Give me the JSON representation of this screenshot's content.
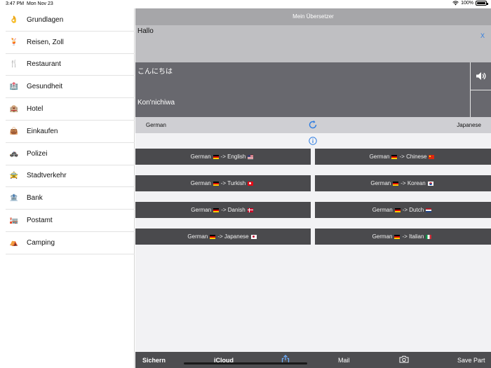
{
  "status_bar": {
    "time": "3:47 PM",
    "date": "Mon Nov 23",
    "battery": "100%"
  },
  "sidebar": {
    "items": [
      {
        "label": "Grundlagen",
        "icon": "ok-hand-icon",
        "glyph": "👌"
      },
      {
        "label": "Reisen, Zoll",
        "icon": "cocktail-icon",
        "glyph": "🍹"
      },
      {
        "label": "Restaurant",
        "icon": "fork-knife-icon",
        "glyph": "🍴"
      },
      {
        "label": "Gesundheit",
        "icon": "hospital-icon",
        "glyph": "🏥"
      },
      {
        "label": "Hotel",
        "icon": "hotel-icon",
        "glyph": "🏨"
      },
      {
        "label": "Einkaufen",
        "icon": "handbag-icon",
        "glyph": "👜"
      },
      {
        "label": "Polizei",
        "icon": "police-car-icon",
        "glyph": "🚓"
      },
      {
        "label": "Stadtverkehr",
        "icon": "taxi-icon",
        "glyph": "🚖"
      },
      {
        "label": "Bank",
        "icon": "bank-icon",
        "glyph": "🏦"
      },
      {
        "label": "Postamt",
        "icon": "post-office-icon",
        "glyph": "🏣"
      },
      {
        "label": "Camping",
        "icon": "tent-icon",
        "glyph": "⛺"
      }
    ]
  },
  "header": {
    "title": "Mein Übersetzer"
  },
  "translator": {
    "input": "Hallo",
    "clear_label": "X",
    "output": "こんにちは",
    "romanization": "Kon'nichiwa",
    "source_lang": "German",
    "target_lang": "Japanese"
  },
  "pairs": [
    {
      "source": "German",
      "arrow": "->",
      "target": "English",
      "target_flag": "us"
    },
    {
      "source": "German",
      "arrow": "->",
      "target": "Chinese",
      "target_flag": "cn"
    },
    {
      "source": "German",
      "arrow": "->",
      "target": "Turkish",
      "target_flag": "tr"
    },
    {
      "source": "German",
      "arrow": "->",
      "target": "Korean",
      "target_flag": "kr"
    },
    {
      "source": "German",
      "arrow": "->",
      "target": "Danish",
      "target_flag": "dk"
    },
    {
      "source": "German",
      "arrow": "->",
      "target": "Dutch",
      "target_flag": "nl"
    },
    {
      "source": "German",
      "arrow": "->",
      "target": "Japanese",
      "target_flag": "jp"
    },
    {
      "source": "German",
      "arrow": "->",
      "target": "Italian",
      "target_flag": "it"
    }
  ],
  "toolbar": {
    "save": "Sichern",
    "icloud": "iCloud",
    "mail": "Mail",
    "save_part": "Save Part"
  },
  "colors": {
    "accent": "#2f7de1",
    "button_dark": "#4a4a4d",
    "output_bg": "#68686e"
  }
}
